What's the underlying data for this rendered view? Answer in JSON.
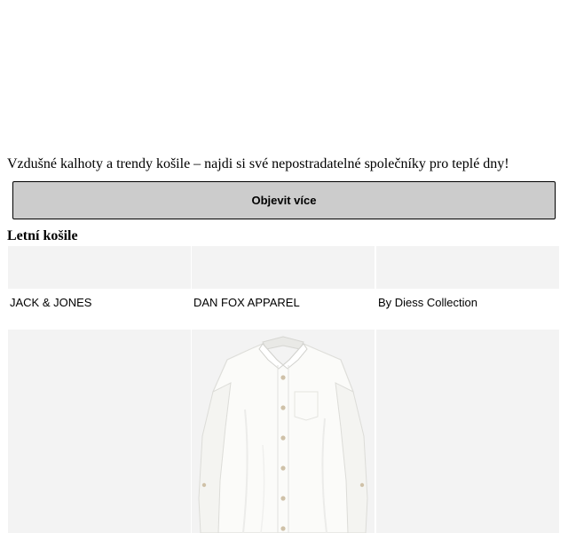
{
  "intro": {
    "text": "Vzdušné kalhoty a trendy košile – najdi si své nepostradatelné společníky pro teplé dny!"
  },
  "more_button": {
    "label": "Objevit více"
  },
  "section": {
    "title": "Letní košile"
  },
  "brands": [
    {
      "name": "JACK & JONES"
    },
    {
      "name": "DAN FOX APPAREL"
    },
    {
      "name": "By Diess Collection"
    }
  ],
  "products": [
    {
      "image": "empty"
    },
    {
      "image": "white-linen-shirt"
    },
    {
      "image": "empty"
    }
  ],
  "colors": {
    "button_bg": "#cccccc",
    "tile_bg": "#f3f3f3"
  }
}
